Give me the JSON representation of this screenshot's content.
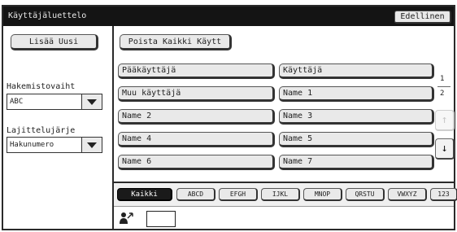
{
  "header": {
    "title": "Käyttäjäluettelo",
    "prev_button": "Edellinen"
  },
  "left": {
    "add_new": "Lisää Uusi",
    "directory_label": "Hakemistovaiht",
    "directory_value": "ABC",
    "sort_label": "Lajittelujärje",
    "sort_value": "Hakunumero"
  },
  "delete_all": "Poista Kaikki Käytt",
  "users": [
    "Pääkäyttäjä",
    "Käyttäjä",
    "Muu käyttäjä",
    "Name 1",
    "Name 2",
    "Name 3",
    "Name 4",
    "Name 5",
    "Name 6",
    "Name 7"
  ],
  "pagination": {
    "current": "1",
    "total": "2"
  },
  "tabs": [
    "Kaikki",
    "ABCD",
    "EFGH",
    "IJKL",
    "MNOP",
    "QRSTU",
    "VWXYZ",
    "123"
  ],
  "icons": {
    "scroll_up": "arrow-up-icon",
    "scroll_down": "arrow-down-icon",
    "user_assign": "user-arrow-icon"
  }
}
